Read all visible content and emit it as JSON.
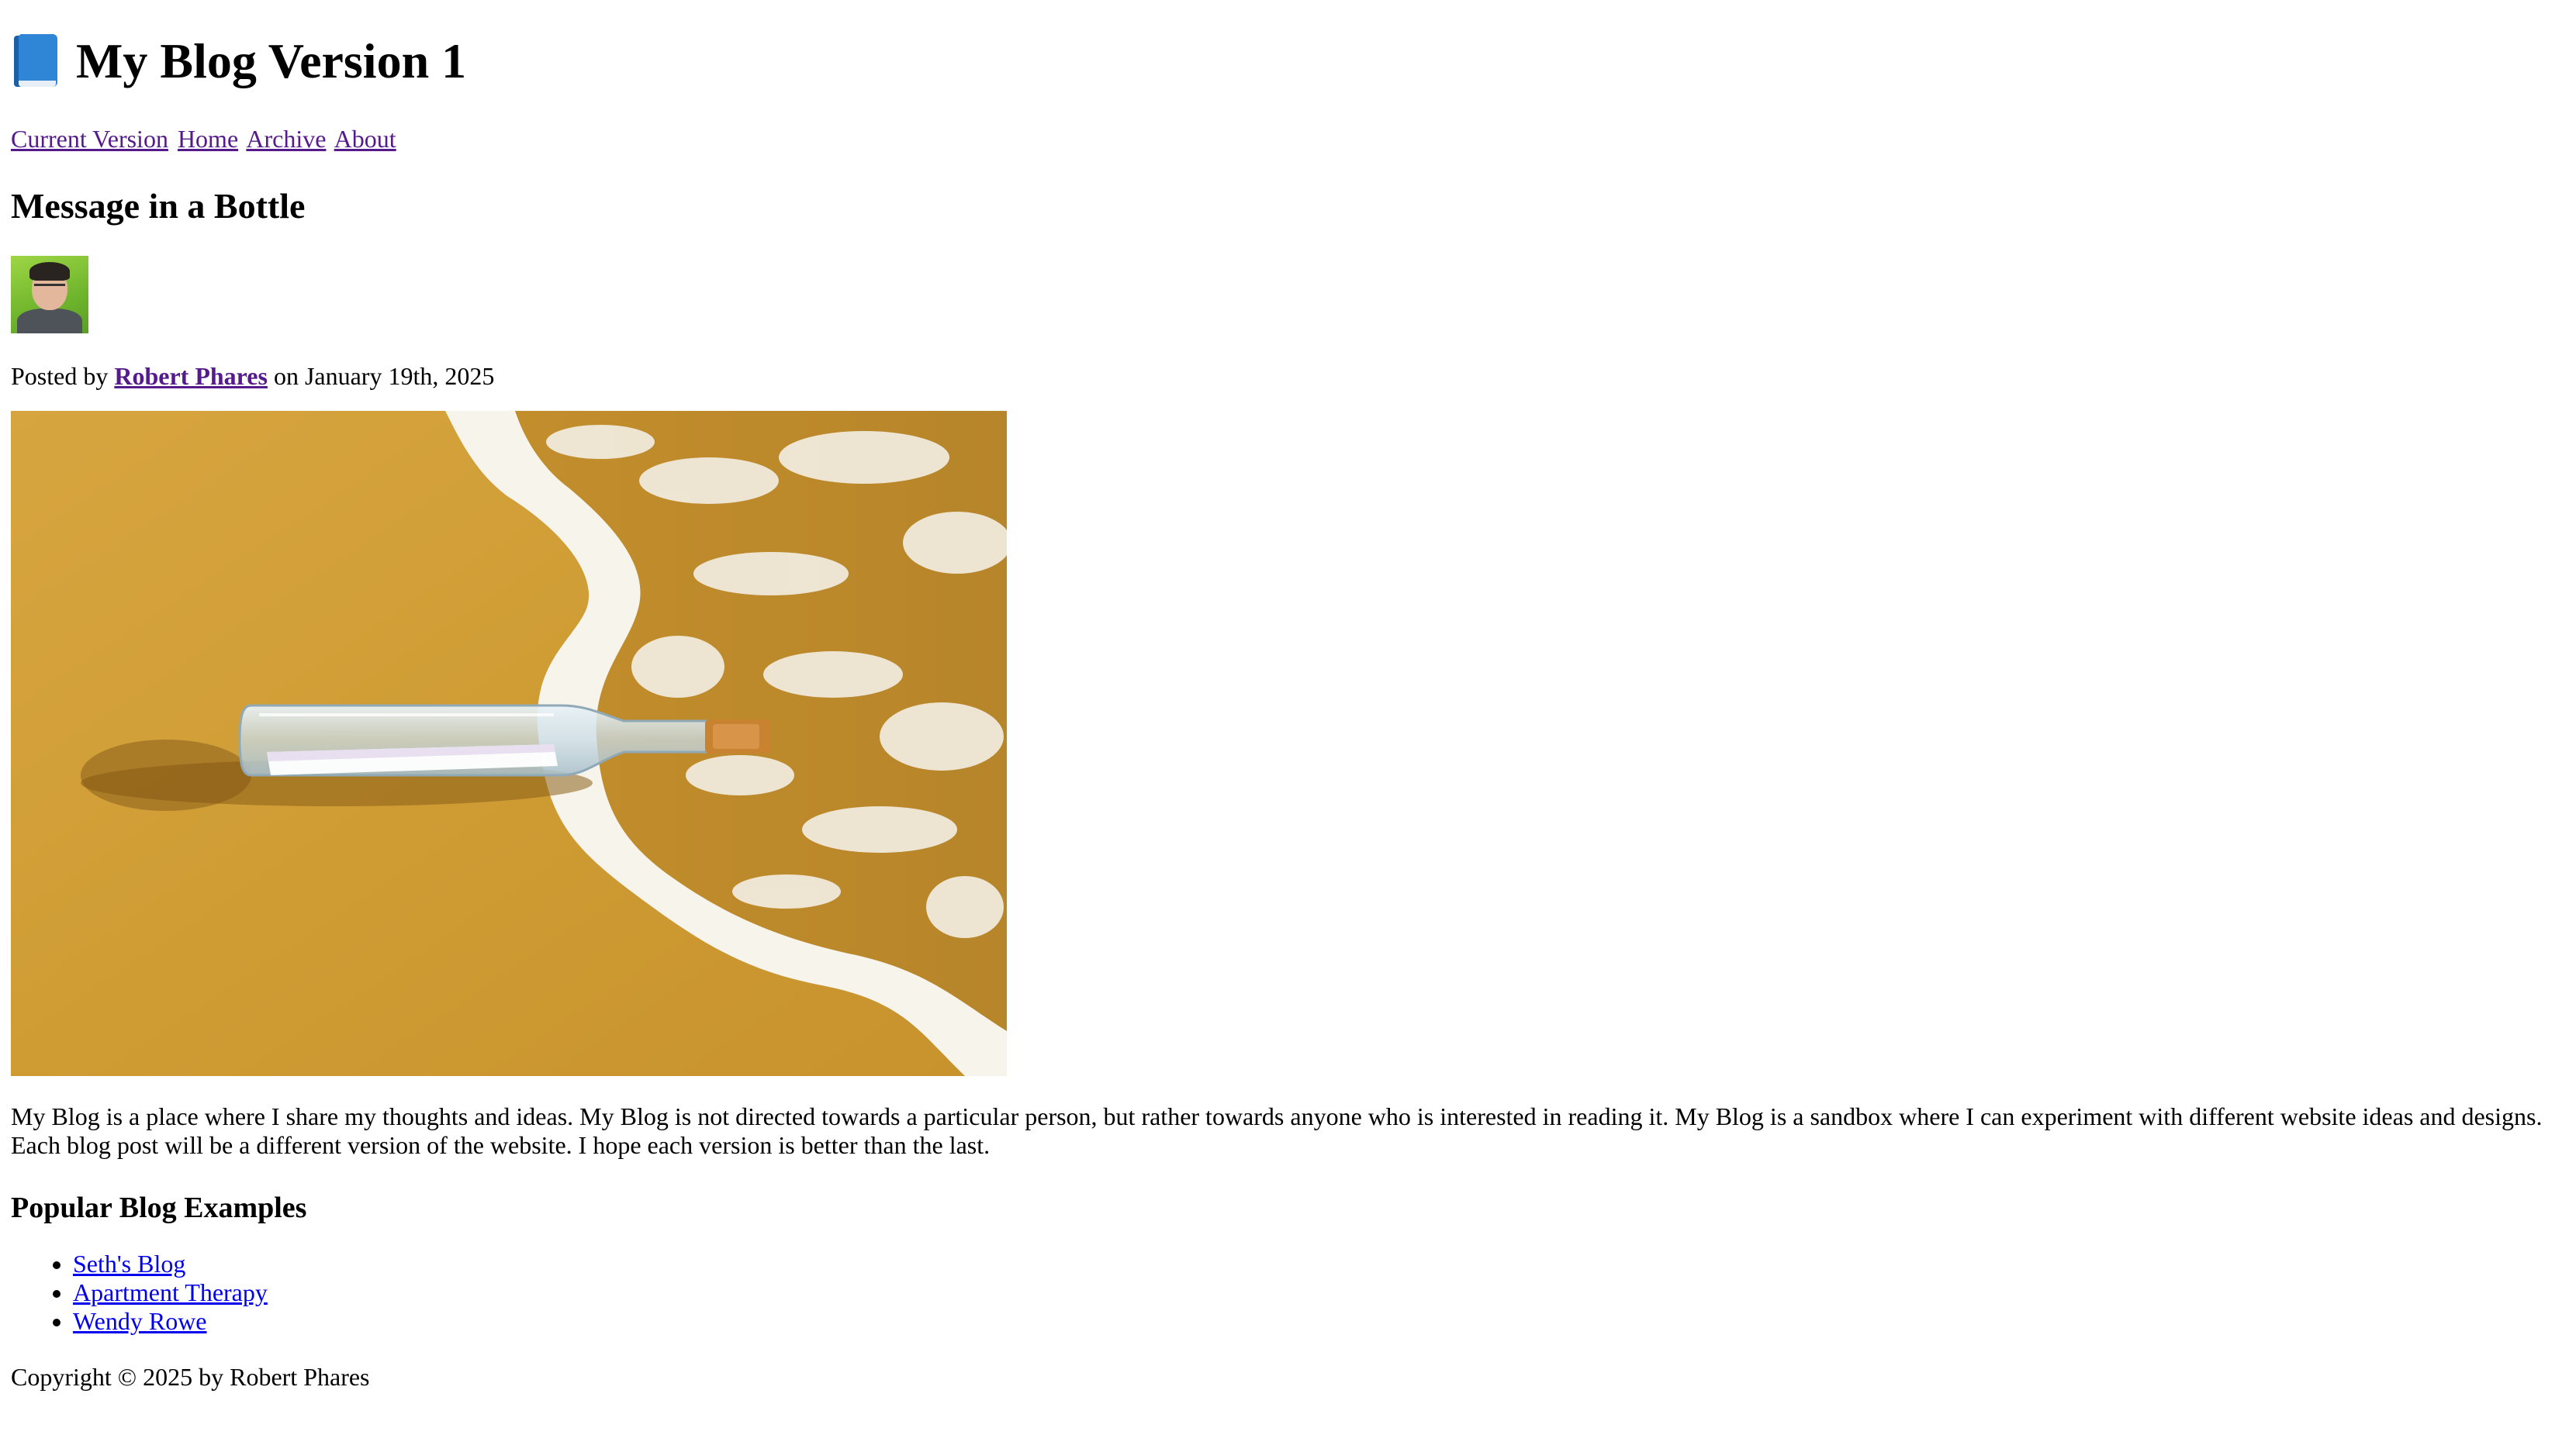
{
  "header": {
    "title": "My Blog Version 1",
    "icon": "book-icon"
  },
  "nav": {
    "items": [
      {
        "label": "Current Version"
      },
      {
        "label": "Home"
      },
      {
        "label": "Archive"
      },
      {
        "label": "About"
      }
    ]
  },
  "post": {
    "title": "Message in a Bottle",
    "byline_prefix": "Posted by",
    "author": "Robert Phares",
    "byline_suffix": "on January 19th, 2025",
    "image_alt": "Message in a bottle on the beach",
    "body": "My Blog is a place where I share my thoughts and ideas. My Blog is not directed towards a particular person, but rather towards anyone who is interested in reading it. My Blog is a sandbox where I can experiment with different website ideas and designs. Each blog post will be a different version of the website. I hope each version is better than the last."
  },
  "popular": {
    "heading": "Popular Blog Examples",
    "items": [
      {
        "label": "Seth's Blog"
      },
      {
        "label": "Apartment Therapy"
      },
      {
        "label": "Wendy Rowe"
      }
    ]
  },
  "footer": {
    "copyright": "Copyright © 2025 by Robert Phares"
  },
  "colors": {
    "visited_link": "#551a8b",
    "link": "#0000ee",
    "sand": "#d2a13a",
    "foam": "#f7f4ec"
  }
}
